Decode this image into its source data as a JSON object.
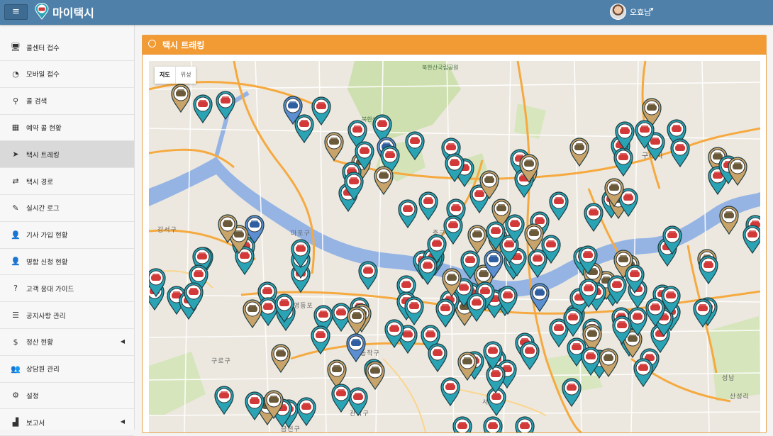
{
  "app": {
    "menu_icon": "hamburger-icon",
    "logo_icon": "taxi-pin-logo",
    "title": "마이택시"
  },
  "user": {
    "name": "오효남",
    "caret_icon": "chevron-down-icon"
  },
  "sidebar": {
    "items": [
      {
        "label": "콜센터 접수",
        "icon": "monitor-icon",
        "glyph": "🖥"
      },
      {
        "label": "모바일 접수",
        "icon": "rss-icon",
        "glyph": "◔"
      },
      {
        "label": "콜 검색",
        "icon": "search-icon",
        "glyph": "⚲"
      },
      {
        "label": "예약 콜 현황",
        "icon": "calendar-icon",
        "glyph": "▦"
      },
      {
        "label": "택시 트레킹",
        "icon": "location-arrow-icon",
        "glyph": "➤",
        "active": true
      },
      {
        "label": "택시 경로",
        "icon": "shuffle-icon",
        "glyph": "⇄"
      },
      {
        "label": "실시간 로그",
        "icon": "edit-icon",
        "glyph": "✎"
      },
      {
        "label": "기사 가입 현황",
        "icon": "user-icon",
        "glyph": "👤"
      },
      {
        "label": "명함 신청 현황",
        "icon": "user-icon",
        "glyph": "👤"
      },
      {
        "label": "고객 응대 가이드",
        "icon": "question-icon",
        "glyph": "?"
      },
      {
        "label": "공지사항 관리",
        "icon": "list-icon",
        "glyph": "☰"
      },
      {
        "label": "정산 현황",
        "icon": "dollar-icon",
        "glyph": "$",
        "submenu": true
      },
      {
        "label": "상담원 관리",
        "icon": "users-icon",
        "glyph": "👥"
      },
      {
        "label": "설정",
        "icon": "gear-icon",
        "glyph": "⚙"
      },
      {
        "label": "보고서",
        "icon": "bar-chart-icon",
        "glyph": "▟",
        "submenu": true
      }
    ]
  },
  "panel": {
    "title": "택시 트래킹",
    "icon": "compass-icon"
  },
  "map": {
    "map_type_buttons": [
      "지도",
      "위성"
    ],
    "places": [
      {
        "text": "북한산국립공원",
        "cls": "green"
      },
      {
        "text": "북한산국립",
        "cls": "green"
      },
      {
        "text": "구리시",
        "cls": "big"
      },
      {
        "text": "강서구",
        "cls": ""
      },
      {
        "text": "마포구",
        "cls": ""
      },
      {
        "text": "중구",
        "cls": ""
      },
      {
        "text": "영등포",
        "cls": ""
      },
      {
        "text": "동작구",
        "cls": ""
      },
      {
        "text": "구로구",
        "cls": ""
      },
      {
        "text": "서초",
        "cls": ""
      },
      {
        "text": "관악구",
        "cls": ""
      },
      {
        "text": "금천구",
        "cls": ""
      },
      {
        "text": "성남",
        "cls": ""
      },
      {
        "text": "산성리",
        "cls": ""
      }
    ],
    "colors": {
      "teal_marker": "#2aa4b5",
      "gold_marker": "#c9a46a",
      "blue_marker": "#5b8fd1",
      "river": "#95b4e4",
      "park": "#cfe0b0",
      "major_road": "#f6a93f",
      "header": "#f29b34",
      "navbar": "#4f80a9"
    }
  }
}
